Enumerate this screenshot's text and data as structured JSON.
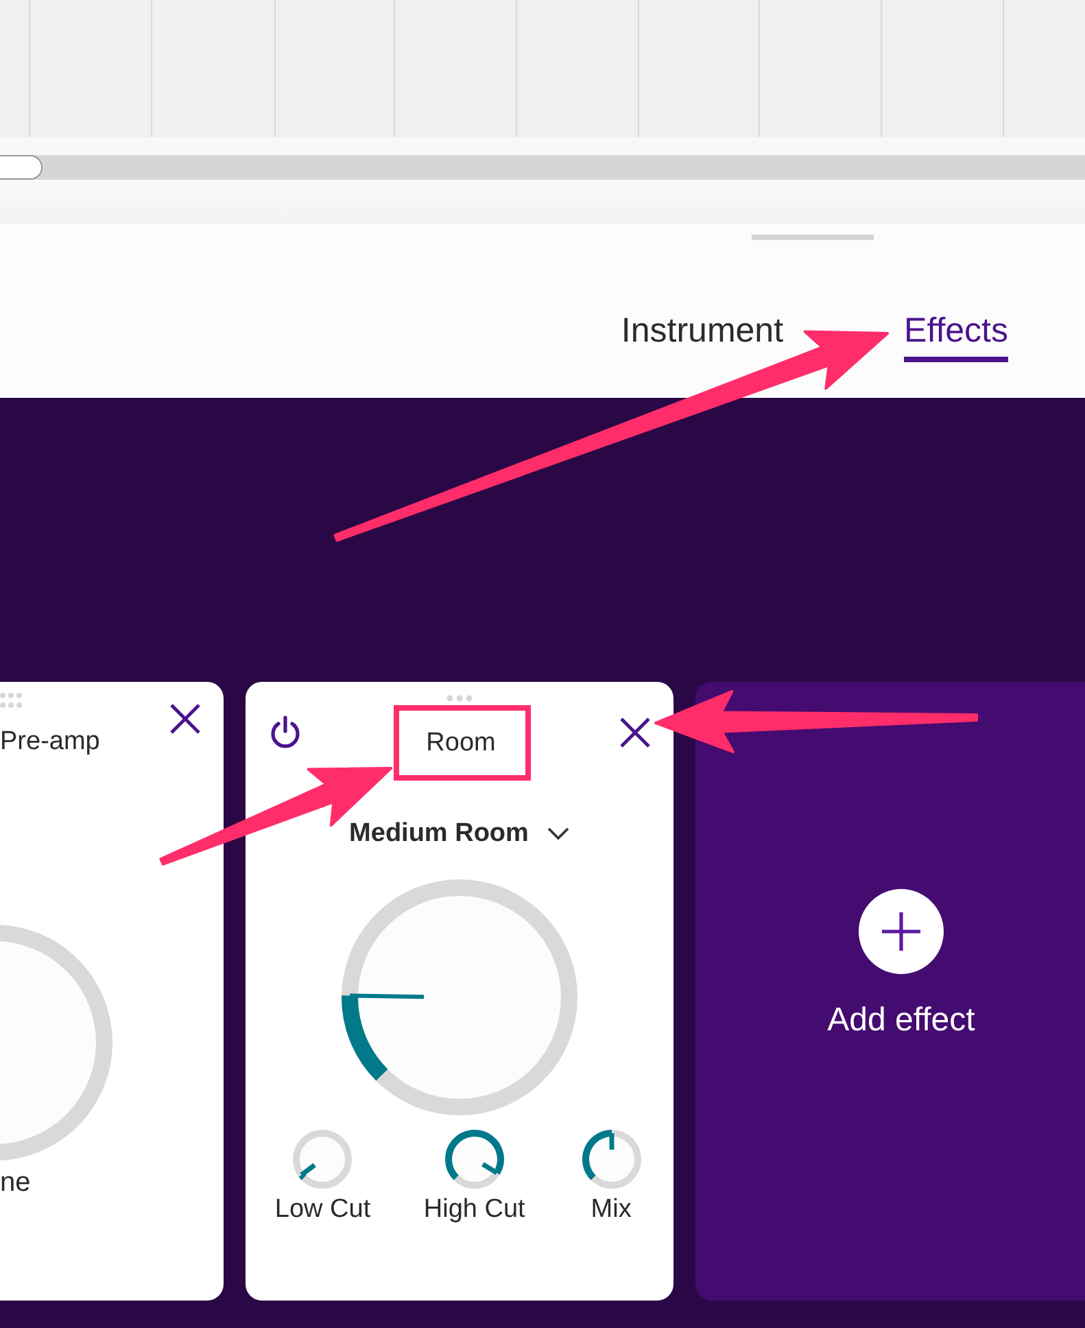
{
  "tabs": [
    {
      "label": "Instrument",
      "selected": false
    },
    {
      "label": "Effects",
      "selected": true
    }
  ],
  "effects": [
    {
      "kind": "clipped",
      "title": "Pre-amp",
      "knob_label": "ne"
    },
    {
      "kind": "full",
      "title": "Room",
      "preset": "Medium Room",
      "level": 0.17,
      "knobs": [
        {
          "label": "Low Cut",
          "level": 0.03
        },
        {
          "label": "High Cut",
          "level": 0.95
        },
        {
          "label": "Mix",
          "level": 0.5
        }
      ]
    }
  ],
  "add_effect": {
    "label": "Add effect"
  }
}
